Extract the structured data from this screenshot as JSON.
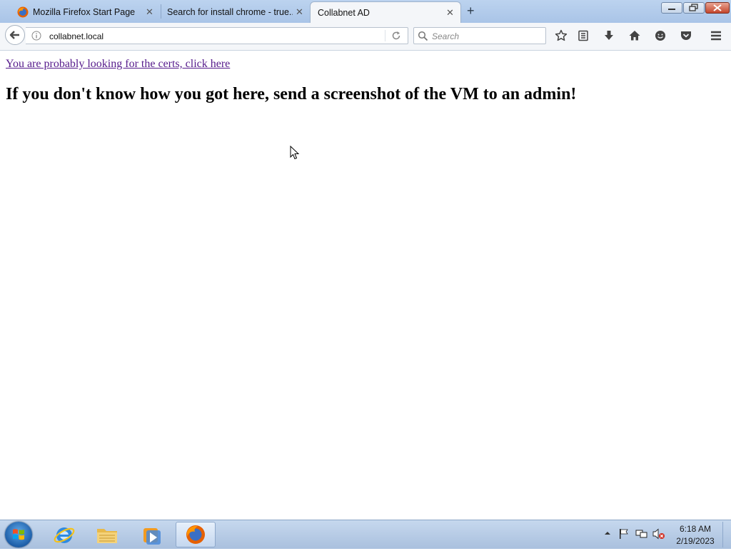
{
  "browser": {
    "tabs": [
      {
        "title": "Mozilla Firefox Start Page",
        "active": false
      },
      {
        "title": "Search for install chrome - true...",
        "active": false
      },
      {
        "title": "Collabnet AD",
        "active": true
      }
    ],
    "url": "collabnet.local",
    "search_placeholder": "Search"
  },
  "page": {
    "cert_link": "You are probably looking for the certs, click here",
    "headline": "If you don't know how you got here, send a screenshot of the VM to an admin!"
  },
  "taskbar": {
    "apps": [
      "internet-explorer",
      "windows-explorer",
      "windows-media-player",
      "firefox"
    ],
    "time": "6:18 AM",
    "date": "2/19/2023"
  },
  "colors": {
    "link_visited": "#551a8b",
    "tabstrip": "#bcd3ef",
    "taskbar": "#c6d8ee"
  }
}
